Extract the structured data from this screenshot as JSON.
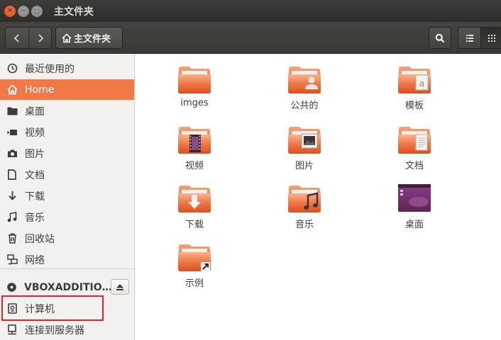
{
  "window": {
    "title": "主文件夹"
  },
  "toolbar": {
    "back_icon": "chevron-left-icon",
    "forward_icon": "chevron-right-icon",
    "path_label": "主文件夹",
    "search_icon": "search-icon",
    "list_view_icon": "list-view-icon",
    "grid_view_icon": "grid-view-icon"
  },
  "sidebar": {
    "items": [
      {
        "label": "最近使用的",
        "icon": "clock-icon"
      },
      {
        "label": "Home",
        "icon": "home-icon",
        "active": true
      },
      {
        "label": "桌面",
        "icon": "folder-icon"
      },
      {
        "label": "视频",
        "icon": "video-icon"
      },
      {
        "label": "图片",
        "icon": "camera-icon"
      },
      {
        "label": "文档",
        "icon": "document-icon"
      },
      {
        "label": "下载",
        "icon": "download-icon"
      },
      {
        "label": "音乐",
        "icon": "music-icon"
      },
      {
        "label": "回收站",
        "icon": "trash-icon"
      },
      {
        "label": "网络",
        "icon": "network-icon"
      }
    ],
    "devices": [
      {
        "label": "VBOXADDITIO…",
        "icon": "disc-icon"
      },
      {
        "label": "计算机",
        "icon": "computer-icon"
      },
      {
        "label": "连接到服务器",
        "icon": "server-icon"
      }
    ]
  },
  "files": [
    {
      "name": "imges",
      "icon": "folder-icon"
    },
    {
      "name": "公共的",
      "icon": "folder-public-icon"
    },
    {
      "name": "模板",
      "icon": "folder-templates-icon"
    },
    {
      "name": "视频",
      "icon": "folder-videos-icon"
    },
    {
      "name": "图片",
      "icon": "folder-pictures-icon"
    },
    {
      "name": "文档",
      "icon": "folder-documents-icon"
    },
    {
      "name": "下载",
      "icon": "folder-download-icon"
    },
    {
      "name": "音乐",
      "icon": "folder-music-icon"
    },
    {
      "name": "桌面",
      "icon": "desktop-icon"
    },
    {
      "name": "示例",
      "icon": "folder-link-icon"
    }
  ],
  "colors": {
    "accent": "#f07746",
    "highlight_box": "#e2252a",
    "titlebar": "#3c3b37"
  }
}
